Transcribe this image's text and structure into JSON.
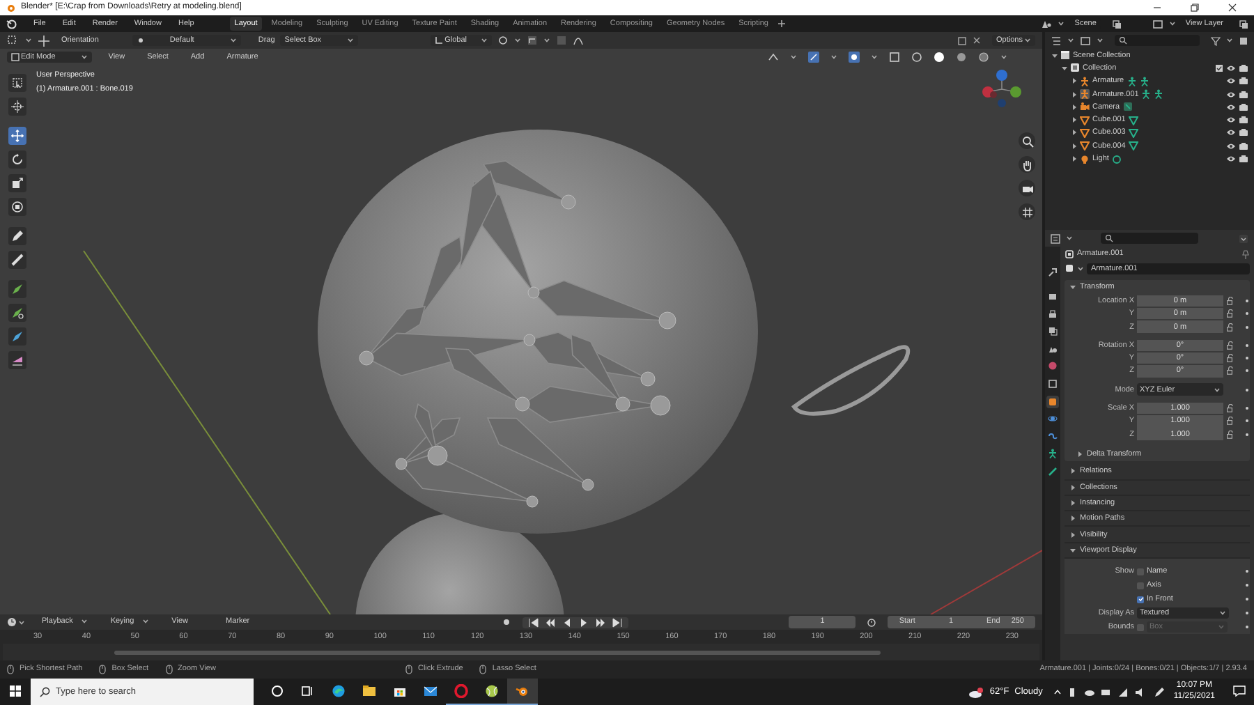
{
  "window": {
    "title": "Blender* [E:\\Crap from Downloads\\Retry at modeling.blend]"
  },
  "menu": [
    "File",
    "Edit",
    "Render",
    "Window",
    "Help"
  ],
  "workspaces": [
    {
      "label": "Layout",
      "selected": true
    },
    {
      "label": "Modeling",
      "selected": false
    },
    {
      "label": "Sculpting",
      "selected": false
    },
    {
      "label": "UV Editing",
      "selected": false
    },
    {
      "label": "Texture Paint",
      "selected": false
    },
    {
      "label": "Shading",
      "selected": false
    },
    {
      "label": "Animation",
      "selected": false
    },
    {
      "label": "Rendering",
      "selected": false
    },
    {
      "label": "Compositing",
      "selected": false
    },
    {
      "label": "Geometry Nodes",
      "selected": false
    },
    {
      "label": "Scripting",
      "selected": false
    }
  ],
  "scene": "Scene",
  "view_layer": "View Layer",
  "tool_header": {
    "orientation_label": "Orientation",
    "pivot": "Default",
    "drag_label": "Drag",
    "drag_value": "Select Box",
    "transform_orientation": "Global",
    "options": "Options"
  },
  "viewport_header": {
    "mode": "Edit Mode",
    "menus": [
      "View",
      "Select",
      "Add",
      "Armature"
    ]
  },
  "viewport_info": [
    "User Perspective",
    "(1) Armature.001 : Bone.019"
  ],
  "tools": [
    {
      "kind": "select",
      "selected": false
    },
    {
      "kind": "cursor",
      "selected": false
    },
    {
      "kind": "move",
      "selected": true
    },
    {
      "kind": "rotate",
      "selected": false
    },
    {
      "kind": "scale",
      "selected": false
    },
    {
      "kind": "transform",
      "selected": false
    },
    {
      "kind": "annotate",
      "selected": false
    },
    {
      "kind": "measure",
      "selected": false
    },
    {
      "kind": "extrude",
      "selected": false
    },
    {
      "kind": "extrude-cursor",
      "selected": false
    },
    {
      "kind": "roll",
      "selected": false
    },
    {
      "kind": "bone-size",
      "selected": false
    }
  ],
  "outliner": {
    "items": [
      {
        "label": "Scene Collection",
        "kind": "scene",
        "expanded": true,
        "selected": false,
        "children": [
          {
            "label": "Collection",
            "kind": "collection",
            "expanded": true,
            "selected": false,
            "children": [
              {
                "label": "Armature",
                "kind": "armature",
                "expanded": false,
                "selected": false
              },
              {
                "label": "Armature.001",
                "kind": "armature",
                "expanded": false,
                "selected": true
              },
              {
                "label": "Camera",
                "kind": "camera",
                "expanded": false,
                "selected": false
              },
              {
                "label": "Cube.001",
                "kind": "mesh",
                "expanded": false,
                "selected": false
              },
              {
                "label": "Cube.003",
                "kind": "mesh",
                "expanded": false,
                "selected": false
              },
              {
                "label": "Cube.004",
                "kind": "mesh",
                "expanded": false,
                "selected": false
              },
              {
                "label": "Light",
                "kind": "light",
                "expanded": false,
                "selected": false
              }
            ]
          }
        ]
      }
    ]
  },
  "properties": {
    "tabs": [
      {
        "kind": "tool",
        "selected": false
      },
      {
        "kind": "render",
        "selected": false
      },
      {
        "kind": "output",
        "selected": false
      },
      {
        "kind": "view-layer",
        "selected": false
      },
      {
        "kind": "scene",
        "selected": false
      },
      {
        "kind": "world",
        "selected": false
      },
      {
        "kind": "collection",
        "selected": false
      },
      {
        "kind": "object",
        "selected": true
      },
      {
        "kind": "physics",
        "selected": false
      },
      {
        "kind": "constraints",
        "selected": false
      },
      {
        "kind": "data",
        "selected": false
      },
      {
        "kind": "bone",
        "selected": false
      }
    ],
    "object_name": "Armature.001",
    "data_name": "Armature.001",
    "transform": {
      "label": "Transform",
      "expanded": true,
      "groups": [
        [
          {
            "kind": "number",
            "label": "Location X",
            "value": "0 m"
          },
          {
            "kind": "number",
            "label": "Y",
            "value": "0 m"
          },
          {
            "kind": "number",
            "label": "Z",
            "value": "0 m"
          }
        ],
        [
          {
            "kind": "number",
            "label": "Rotation X",
            "value": "0°"
          },
          {
            "kind": "number",
            "label": "Y",
            "value": "0°"
          },
          {
            "kind": "number",
            "label": "Z",
            "value": "0°"
          }
        ],
        [
          {
            "kind": "dropdown",
            "label": "Mode",
            "value": "XYZ Euler"
          }
        ],
        [
          {
            "kind": "number",
            "label": "Scale X",
            "value": "1.000"
          },
          {
            "kind": "number",
            "label": "Y",
            "value": "1.000"
          },
          {
            "kind": "number",
            "label": "Z",
            "value": "1.000"
          }
        ]
      ],
      "subpanels": [
        {
          "label": "Delta Transform",
          "expanded": false
        }
      ]
    },
    "sections": [
      {
        "label": "Relations",
        "expanded": false
      },
      {
        "label": "Collections",
        "expanded": false
      },
      {
        "label": "Instancing",
        "expanded": false
      },
      {
        "label": "Motion Paths",
        "expanded": false
      },
      {
        "label": "Visibility",
        "expanded": false
      },
      {
        "label": "Viewport Display",
        "expanded": true
      }
    ],
    "viewport_display": [
      {
        "kind": "checkbox",
        "label": "Show",
        "text": "Name",
        "checked": false
      },
      {
        "kind": "checkbox",
        "text": "Axis",
        "checked": false
      },
      {
        "kind": "checkbox",
        "text": "In Front",
        "checked": true
      },
      {
        "kind": "dropdown",
        "label": "Display As",
        "value": "Textured"
      },
      {
        "kind": "checkbox-dropdown",
        "label": "Bounds",
        "checked": false,
        "value": "Box",
        "disabled": true
      }
    ]
  },
  "timeline": {
    "menus": [
      {
        "label": "Playback",
        "dropdown": true
      },
      {
        "label": "Keying",
        "dropdown": true
      },
      {
        "label": "View",
        "dropdown": false
      },
      {
        "label": "Marker",
        "dropdown": false
      }
    ],
    "current_frame": "1",
    "start_label": "Start",
    "start": "1",
    "end_label": "End",
    "end": "250",
    "ruler": [
      "30",
      "40",
      "50",
      "60",
      "70",
      "80",
      "90",
      "100",
      "110",
      "120",
      "130",
      "140",
      "150",
      "160",
      "170",
      "180",
      "190",
      "200",
      "210",
      "220",
      "230"
    ]
  },
  "status_bar": {
    "hints": [
      "Pick Shortest Path",
      "Box Select",
      "Zoom View",
      "Click Extrude",
      "Lasso Select"
    ],
    "stats": "Armature.001 | Joints:0/24 | Bones:0/21 | Objects:1/7 | 2.93.4"
  },
  "taskbar": {
    "search_placeholder": "Type here to search",
    "apps": [
      {
        "kind": "cortana",
        "running": false,
        "selected": false
      },
      {
        "kind": "task-view",
        "running": false,
        "selected": false
      },
      {
        "kind": "edge",
        "running": false,
        "selected": false
      },
      {
        "kind": "explorer",
        "running": false,
        "selected": false
      },
      {
        "kind": "store",
        "running": false,
        "selected": false
      },
      {
        "kind": "mail",
        "running": false,
        "selected": false
      },
      {
        "kind": "opera",
        "running": true,
        "selected": false
      },
      {
        "kind": "ball",
        "running": true,
        "selected": false
      },
      {
        "kind": "blender",
        "running": true,
        "selected": true
      }
    ],
    "temperature": "62°F",
    "weather": "Cloudy",
    "time": "10:07 PM",
    "date": "11/25/2021"
  }
}
